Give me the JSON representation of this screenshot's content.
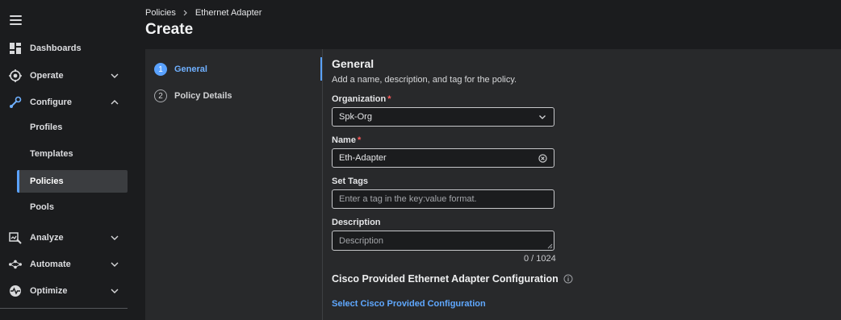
{
  "sidebar": {
    "items": [
      {
        "label": "Dashboards",
        "icon": "dashboard-icon"
      },
      {
        "label": "Operate",
        "icon": "operate-icon"
      },
      {
        "label": "Configure",
        "icon": "configure-icon"
      },
      {
        "label": "Analyze",
        "icon": "analyze-icon"
      },
      {
        "label": "Automate",
        "icon": "automate-icon"
      },
      {
        "label": "Optimize",
        "icon": "optimize-icon"
      }
    ],
    "configure_sub": [
      "Profiles",
      "Templates",
      "Policies",
      "Pools"
    ],
    "active_sub": "Policies"
  },
  "breadcrumb": {
    "parent": "Policies",
    "current": "Ethernet Adapter"
  },
  "page_title": "Create",
  "steps": [
    {
      "number": "1",
      "label": "General"
    },
    {
      "number": "2",
      "label": "Policy Details"
    }
  ],
  "form": {
    "section_title": "General",
    "section_subtitle": "Add a name, description, and tag for the policy.",
    "organization_label": "Organization",
    "organization_value": "Spk-Org",
    "name_label": "Name",
    "name_value": "Eth-Adapter",
    "tags_label": "Set Tags",
    "tags_placeholder": "Enter a tag in the key:value format.",
    "description_label": "Description",
    "description_placeholder": "Description",
    "char_count": "0 / 1024",
    "required_marker": "*",
    "config_title": "Cisco Provided Ethernet Adapter Configuration",
    "config_link": "Select Cisco Provided Configuration"
  },
  "colors": {
    "accent": "#5aa2ff",
    "required": "#ff5a5a",
    "background": "#1b1c1e",
    "panel": "#28292b"
  }
}
